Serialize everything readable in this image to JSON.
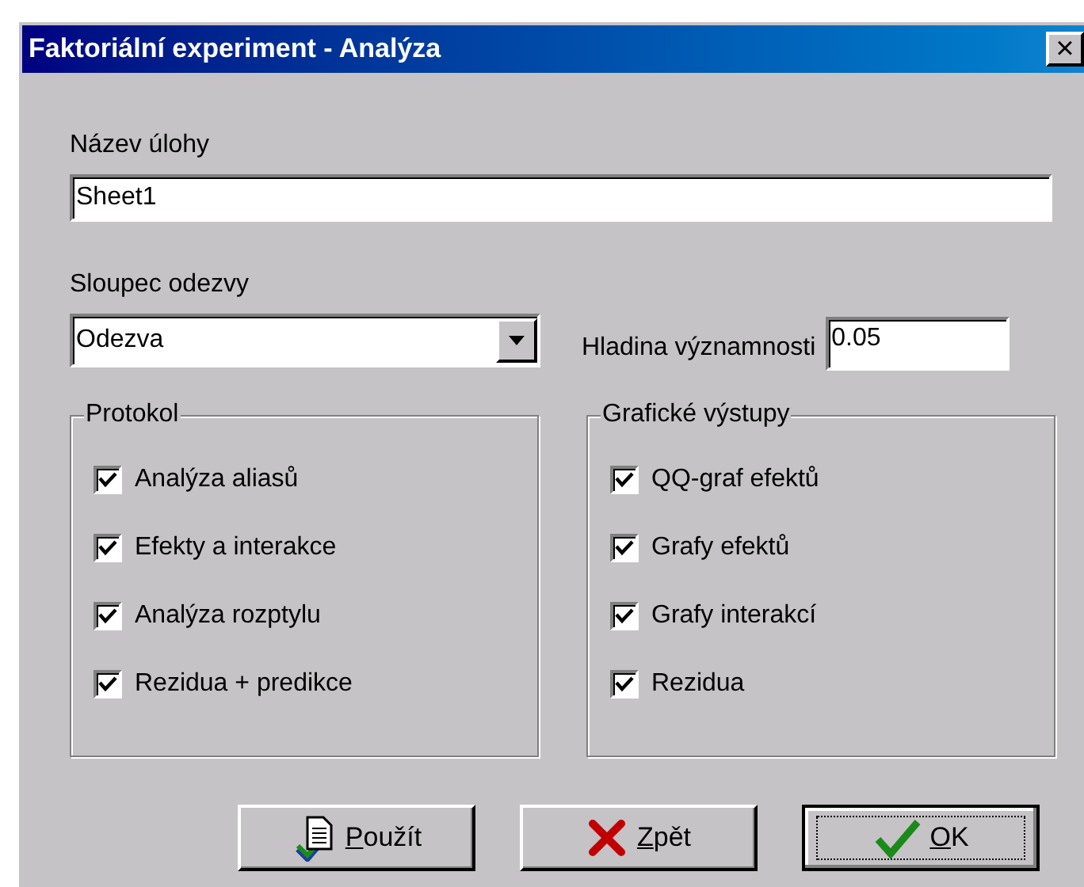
{
  "window": {
    "title": "Faktoriální experiment - Analýza",
    "close": "×"
  },
  "task_name": {
    "label": "Název úlohy",
    "value": "Sheet1"
  },
  "response_column": {
    "label": "Sloupec odezvy",
    "value": "Odezva"
  },
  "significance": {
    "label": "Hladina významnosti",
    "value": "0.05"
  },
  "groups": [
    {
      "title": "Protokol",
      "items": [
        {
          "label": "Analýza aliasů",
          "checked": true
        },
        {
          "label": "Efekty a interakce",
          "checked": true
        },
        {
          "label": "Analýza rozptylu",
          "checked": true
        },
        {
          "label": "Rezidua + predikce",
          "checked": true
        }
      ]
    },
    {
      "title": "Grafické výstupy",
      "items": [
        {
          "label": "QQ-graf efektů",
          "checked": true
        },
        {
          "label": "Grafy efektů",
          "checked": true
        },
        {
          "label": "Grafy interakcí",
          "checked": true
        },
        {
          "label": "Rezidua",
          "checked": true
        }
      ]
    }
  ],
  "buttons": [
    {
      "kind": "apply",
      "label": "Použít",
      "default": false
    },
    {
      "kind": "cancel",
      "label": "Zpět",
      "default": false
    },
    {
      "kind": "ok",
      "label": "OK",
      "default": true
    }
  ]
}
